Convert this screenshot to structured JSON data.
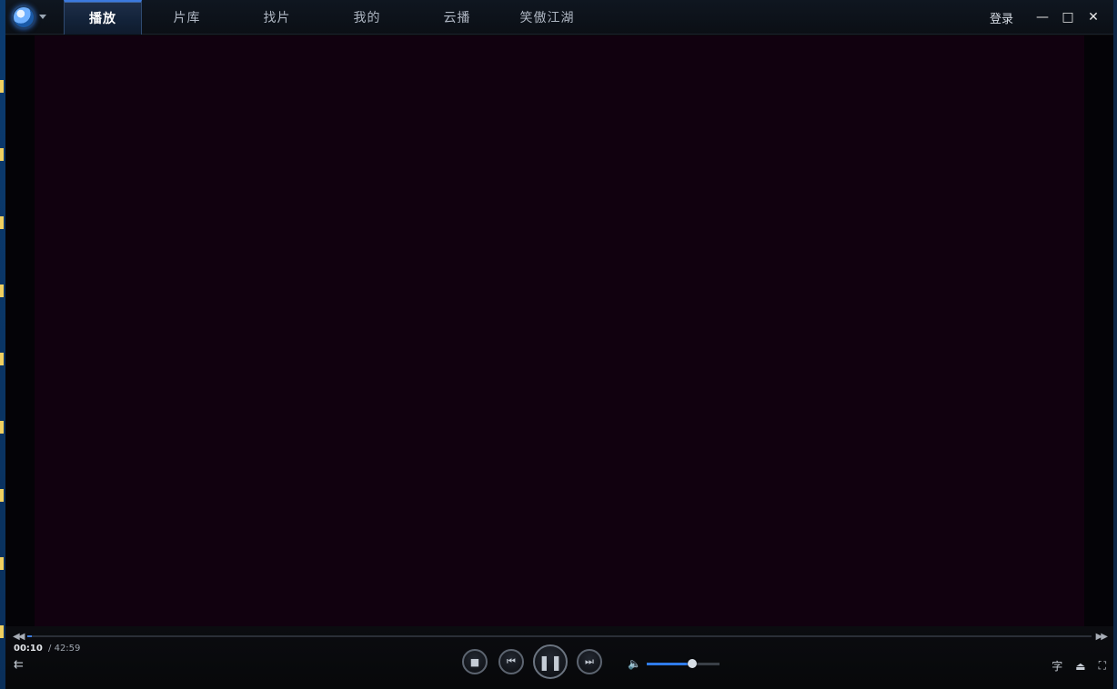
{
  "titlebar": {
    "logo_icon": "player-logo-icon",
    "tabs": [
      {
        "label": "播放",
        "active": true
      },
      {
        "label": "片库",
        "active": false
      },
      {
        "label": "找片",
        "active": false
      },
      {
        "label": "我的",
        "active": false
      },
      {
        "label": "云播",
        "active": false
      },
      {
        "label": "笑傲江湖",
        "active": false
      }
    ],
    "login_label": "登录",
    "minimize_glyph": "—",
    "maximize_glyph": "□",
    "close_glyph": "✕"
  },
  "player": {
    "current_time": "00:10",
    "total_time": "/ 42:59",
    "progress": 0.004,
    "volume": 0.62
  },
  "controls": {
    "seek_back_glyph": "◀◀",
    "seek_fwd_glyph": "▶▶",
    "playlist_glyph": "⇇",
    "stop_glyph": "■",
    "prev_glyph": "⏮",
    "pause_glyph": "❚❚",
    "next_glyph": "⏭",
    "volume_glyph": "🔈",
    "subtitle_label": "字",
    "eject_glyph": "⏏",
    "fullscreen_glyph": "⛶"
  },
  "colors": {
    "accent": "#3c7de0",
    "video_bg": "#11010f"
  }
}
